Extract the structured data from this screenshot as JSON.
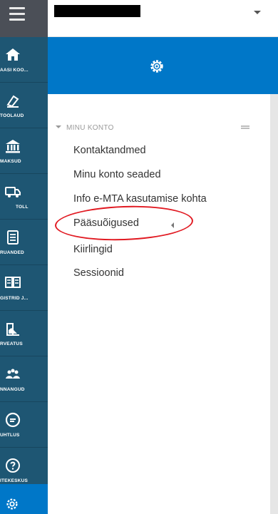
{
  "header": {
    "redacted_title": "",
    "dropdown_icon": "caret-down-icon"
  },
  "gear_panel": {
    "icon": "gear-icon"
  },
  "left_nav": {
    "menu_icon": "hamburger-icon",
    "items": [
      {
        "label": "AASI KOO...",
        "icon": "home-icon"
      },
      {
        "label": "TÖÖLAUD",
        "icon": "workdesk-icon"
      },
      {
        "label": "MAKSUD",
        "icon": "bank-icon"
      },
      {
        "label": "TOLL",
        "icon": "truck-icon"
      },
      {
        "label": "RUANDED",
        "icon": "document-icon"
      },
      {
        "label": "GISTRID J...",
        "icon": "registry-icon"
      },
      {
        "label": "RVEATUS",
        "icon": "correction-icon"
      },
      {
        "label": "NNANGUD",
        "icon": "people-icon"
      },
      {
        "label": "UHTLUS",
        "icon": "message-icon"
      },
      {
        "label": "ITEKESKUS",
        "icon": "help-icon"
      },
      {
        "label": "",
        "icon": "settings-icon"
      }
    ]
  },
  "section": {
    "title": "MINU KONTO",
    "items": [
      {
        "label": "Kontaktandmed"
      },
      {
        "label": "Minu konto seaded"
      },
      {
        "label": "Info e-MTA kasutamise kohta"
      },
      {
        "label": "Pääsuõigused"
      },
      {
        "label": "Kiirlingid"
      },
      {
        "label": "Sessioonid"
      }
    ]
  },
  "colors": {
    "nav_bg": "#1e5673",
    "accent": "#0077c8",
    "highlight_circle": "#e11a22"
  }
}
